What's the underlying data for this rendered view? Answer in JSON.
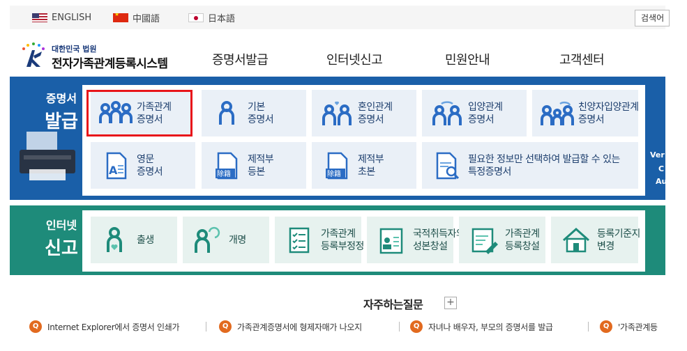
{
  "lang_bar": {
    "languages": [
      {
        "label": "ENGLISH",
        "flag": "us-flag-icon"
      },
      {
        "label": "中國語",
        "flag": "cn-flag-icon"
      },
      {
        "label": "日本語",
        "flag": "jp-flag-icon"
      }
    ],
    "search_label": "검색어"
  },
  "header": {
    "logo_sub": "대한민국 법원",
    "logo_main": "전자가족관계등록시스템",
    "nav": [
      "증명서발급",
      "인터넷신고",
      "민원안내",
      "고객센터"
    ]
  },
  "certificate_section": {
    "title_small": "증명서",
    "title_big": "발급",
    "row1": [
      {
        "line1": "가족관계",
        "line2": "증명서"
      },
      {
        "line1": "기본",
        "line2": "증명서"
      },
      {
        "line1": "혼인관계",
        "line2": "증명서"
      },
      {
        "line1": "입양관계",
        "line2": "증명서"
      },
      {
        "line1": "친양자입양관계",
        "line2": "증명서"
      }
    ],
    "row2": [
      {
        "line1": "영문",
        "line2": "증명서"
      },
      {
        "line1": "제적부",
        "line2": "등본"
      },
      {
        "line1": "제적부",
        "line2": "초본"
      },
      {
        "line1": "필요한 정보만 선택하여 발급할 수 있는",
        "line2": "특정증명서"
      }
    ],
    "right_clip": [
      "Ver",
      "C",
      "Au"
    ]
  },
  "report_section": {
    "title_small": "인터넷",
    "title_big": "신고",
    "items": [
      {
        "line1": "출생",
        "line2": ""
      },
      {
        "line1": "개명",
        "line2": ""
      },
      {
        "line1": "가족관계",
        "line2": "등록부정정"
      },
      {
        "line1": "국적취득자의",
        "line2": "성본창설"
      },
      {
        "line1": "가족관계",
        "line2": "등록창설"
      },
      {
        "line1": "등록기준지",
        "line2": "변경"
      }
    ]
  },
  "faq": {
    "title": "자주하는질문",
    "plus": "+",
    "items": [
      "Internet Explorer에서 증명서 인쇄가",
      "가족관계증명서에 형제자매가 나오지",
      "자녀나 배우자, 부모의 증명서를 발급",
      "'가족관계등"
    ]
  },
  "colors": {
    "certificate_panel": "#1a5fa8",
    "report_panel": "#1e8b7a",
    "highlight": "#e8151a",
    "faq_icon": "#e26a1f"
  }
}
